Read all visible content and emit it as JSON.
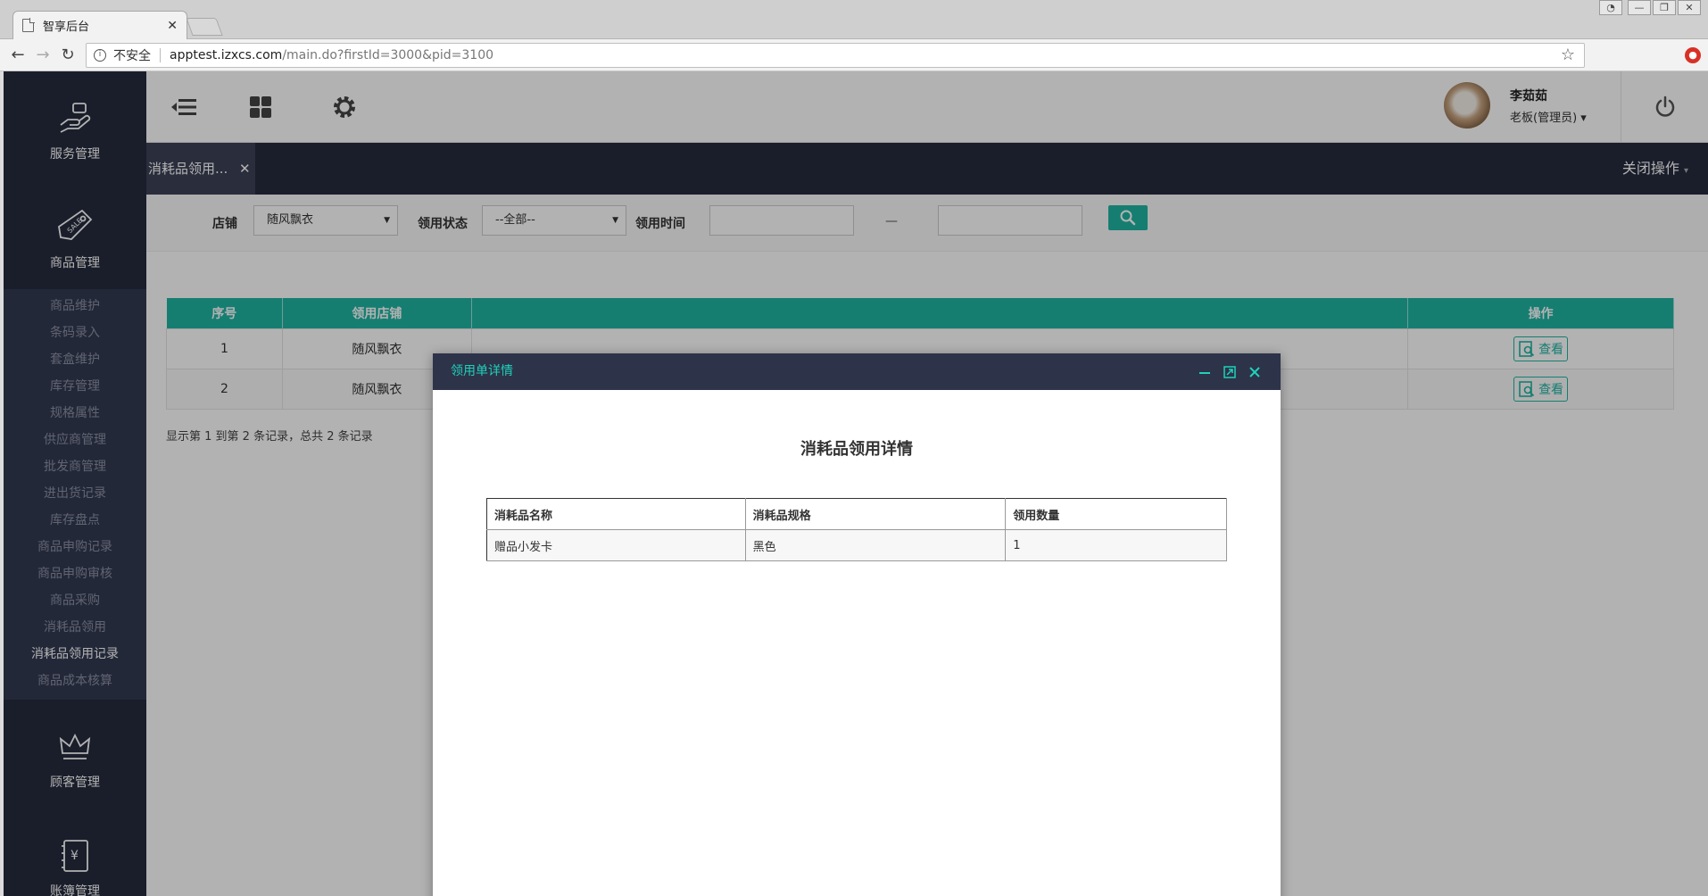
{
  "browser": {
    "tab_title": "智享后台",
    "tab_close": "✕",
    "security_label": "不安全",
    "url_host": "apptest.izxcs.com",
    "url_path": "/main.do?firstId=3000&pid=3100"
  },
  "sidebar": {
    "modules": [
      {
        "label": "服务管理",
        "icon": "service-hand-icon"
      },
      {
        "label": "商品管理",
        "icon": "sale-tag-icon"
      },
      {
        "label": "顾客管理",
        "icon": "crown-icon"
      },
      {
        "label": "账簿管理",
        "icon": "ledger-icon"
      }
    ],
    "goods_submenu": [
      "商品维护",
      "条码录入",
      "套盒维护",
      "库存管理",
      "规格属性",
      "供应商管理",
      "批发商管理",
      "进出货记录",
      "库存盘点",
      "商品申购记录",
      "商品申购审核",
      "商品采购",
      "消耗品领用",
      "消耗品领用记录",
      "商品成本核算"
    ],
    "active_item": "消耗品领用记录"
  },
  "topbar": {
    "user_name": "李茹茹",
    "user_role": "老板(管理员)",
    "role_caret": "▾"
  },
  "tabs": {
    "current_tab": "消耗品领用...",
    "tab_close": "✕",
    "close_ops": "关闭操作",
    "close_ops_caret": "▾"
  },
  "filter": {
    "store_label": "店铺",
    "store_value": "随风飘衣",
    "status_label": "领用状态",
    "status_value": "--全部--",
    "time_label": "领用时间",
    "time_sep": "—",
    "caret": "▼"
  },
  "grid": {
    "columns": [
      "序号",
      "领用店铺",
      "",
      "操作"
    ],
    "rows": [
      {
        "index": "1",
        "store": "随风飘衣",
        "action": "查看"
      },
      {
        "index": "2",
        "store": "随风飘衣",
        "action": "查看"
      }
    ],
    "pager_text": "显示第 1 到第 2 条记录，总共 2 条记录"
  },
  "modal": {
    "header_title": "领用单详情",
    "title": "消耗品领用详情",
    "columns": [
      "消耗品名称",
      "消耗品规格",
      "领用数量"
    ],
    "rows": [
      [
        "赠品小发卡",
        "黑色",
        "1"
      ]
    ],
    "close_label": "关闭"
  },
  "colors": {
    "accent": "#1fb5a3",
    "sidebar_bg": "#262b3e",
    "modal_header_bg": "#2d3349"
  }
}
